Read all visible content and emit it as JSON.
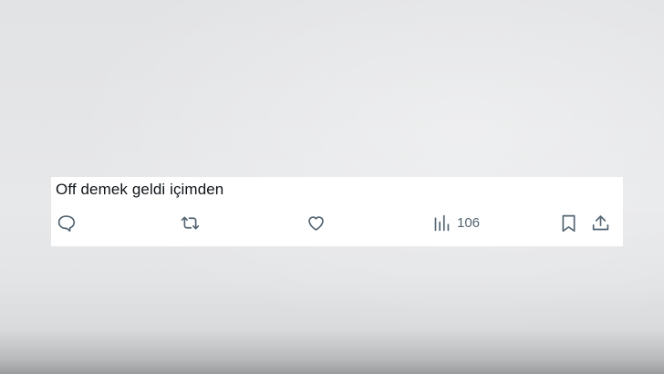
{
  "tweet": {
    "text": "Off demek geldi içimden",
    "actions": {
      "reply_icon": "speech-bubble-outline",
      "retweet_icon": "retweet-arrows",
      "like_icon": "heart-outline",
      "views_icon": "bar-chart",
      "views_count": "106",
      "bookmark_icon": "bookmark-outline",
      "share_icon": "upload-arrow"
    }
  },
  "colors": {
    "text": "#0f1419",
    "icon": "#536471",
    "card_background": "#ffffff"
  }
}
